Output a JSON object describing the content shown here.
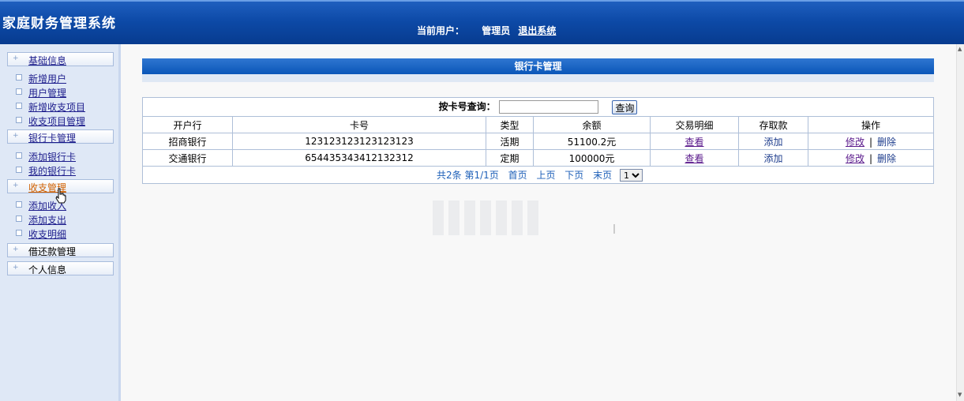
{
  "header": {
    "app_title": "家庭财务管理系统",
    "current_user_label": "当前用户：",
    "current_user": "管理员",
    "logout": "退出系统"
  },
  "sidebar": {
    "groups": [
      {
        "label": "基础信息",
        "items": [
          "新增用户",
          "用户管理",
          "新增收支项目",
          "收支项目管理"
        ]
      },
      {
        "label": "银行卡管理",
        "items": [
          "添加银行卡",
          "我的银行卡"
        ]
      },
      {
        "label": "收支管理",
        "items": [
          "添加收入",
          "添加支出",
          "收支明细"
        ]
      },
      {
        "label": "借还款管理",
        "items": []
      },
      {
        "label": "个人信息",
        "items": []
      }
    ]
  },
  "main": {
    "title": "银行卡管理",
    "search": {
      "label": "按卡号查询：",
      "value": "",
      "button": "查询"
    },
    "table": {
      "headers": [
        "开户行",
        "卡号",
        "类型",
        "余额",
        "交易明细",
        "存取款",
        "操作"
      ],
      "rows": [
        {
          "bank": "招商银行",
          "card": "123123123123123123",
          "type": "活期",
          "balance": "51100.2元",
          "detail": "查看",
          "deposit": "添加",
          "edit": "修改",
          "sep": "|",
          "delete": "删除"
        },
        {
          "bank": "交通银行",
          "card": "654435343412132312",
          "type": "定期",
          "balance": "100000元",
          "detail": "查看",
          "deposit": "添加",
          "edit": "修改",
          "sep": "|",
          "delete": "删除"
        }
      ]
    },
    "pager": {
      "summary": "共2条 第1/1页",
      "first": "首页",
      "prev": "上页",
      "next": "下页",
      "last": "末页",
      "page_value": "1"
    }
  },
  "colors": {
    "header": "#0d4aa7",
    "sidebar": "#dfe8f6",
    "link": "#5a1a8c"
  },
  "icons": {
    "cursor": "hand-pointer-icon"
  }
}
